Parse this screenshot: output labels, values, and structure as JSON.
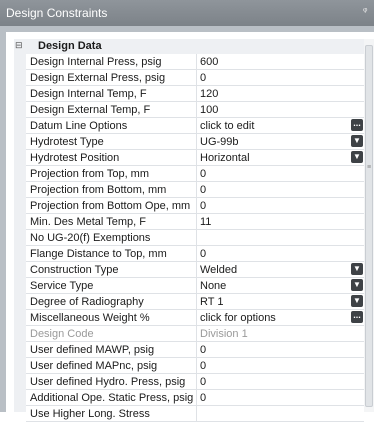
{
  "window": {
    "title": "Design Constraints"
  },
  "category": {
    "label": "Design Data",
    "collapse_glyph": "⊟"
  },
  "rows": [
    {
      "name": "Design Internal Press, psig",
      "value": "600"
    },
    {
      "name": "Design External Press, psig",
      "value": "0"
    },
    {
      "name": "Design Internal Temp, F",
      "value": "120"
    },
    {
      "name": "Design External Temp, F",
      "value": "100"
    },
    {
      "name": "Datum Line Options",
      "value": "click to edit",
      "button": "ellipsis"
    },
    {
      "name": "Hydrotest Type",
      "value": "UG-99b",
      "button": "dropdown"
    },
    {
      "name": "Hydrotest Position",
      "value": "Horizontal",
      "button": "dropdown"
    },
    {
      "name": "Projection from Top, mm",
      "value": "0"
    },
    {
      "name": "Projection from Bottom, mm",
      "value": "0"
    },
    {
      "name": "Projection from Bottom Ope, mm",
      "value": "0"
    },
    {
      "name": "Min. Des Metal Temp, F",
      "value": "11"
    },
    {
      "name": "No UG-20(f) Exemptions",
      "value": ""
    },
    {
      "name": "Flange Distance to Top, mm",
      "value": "0"
    },
    {
      "name": "Construction Type",
      "value": "Welded",
      "button": "dropdown"
    },
    {
      "name": "Service Type",
      "value": "None",
      "button": "dropdown"
    },
    {
      "name": "Degree of Radiography",
      "value": "RT 1",
      "button": "dropdown"
    },
    {
      "name": "Miscellaneous Weight %",
      "value": "click for options",
      "button": "ellipsis"
    },
    {
      "name": "Design Code",
      "value": "Division 1",
      "disabled": true
    },
    {
      "name": "User defined MAWP, psig",
      "value": "0"
    },
    {
      "name": "User defined MAPnc, psig",
      "value": "0"
    },
    {
      "name": "User defined Hydro. Press, psig",
      "value": "0"
    },
    {
      "name": "Additional Ope. Static Press, psig",
      "value": "0"
    },
    {
      "name": "Use Higher Long. Stress",
      "value": ""
    }
  ]
}
